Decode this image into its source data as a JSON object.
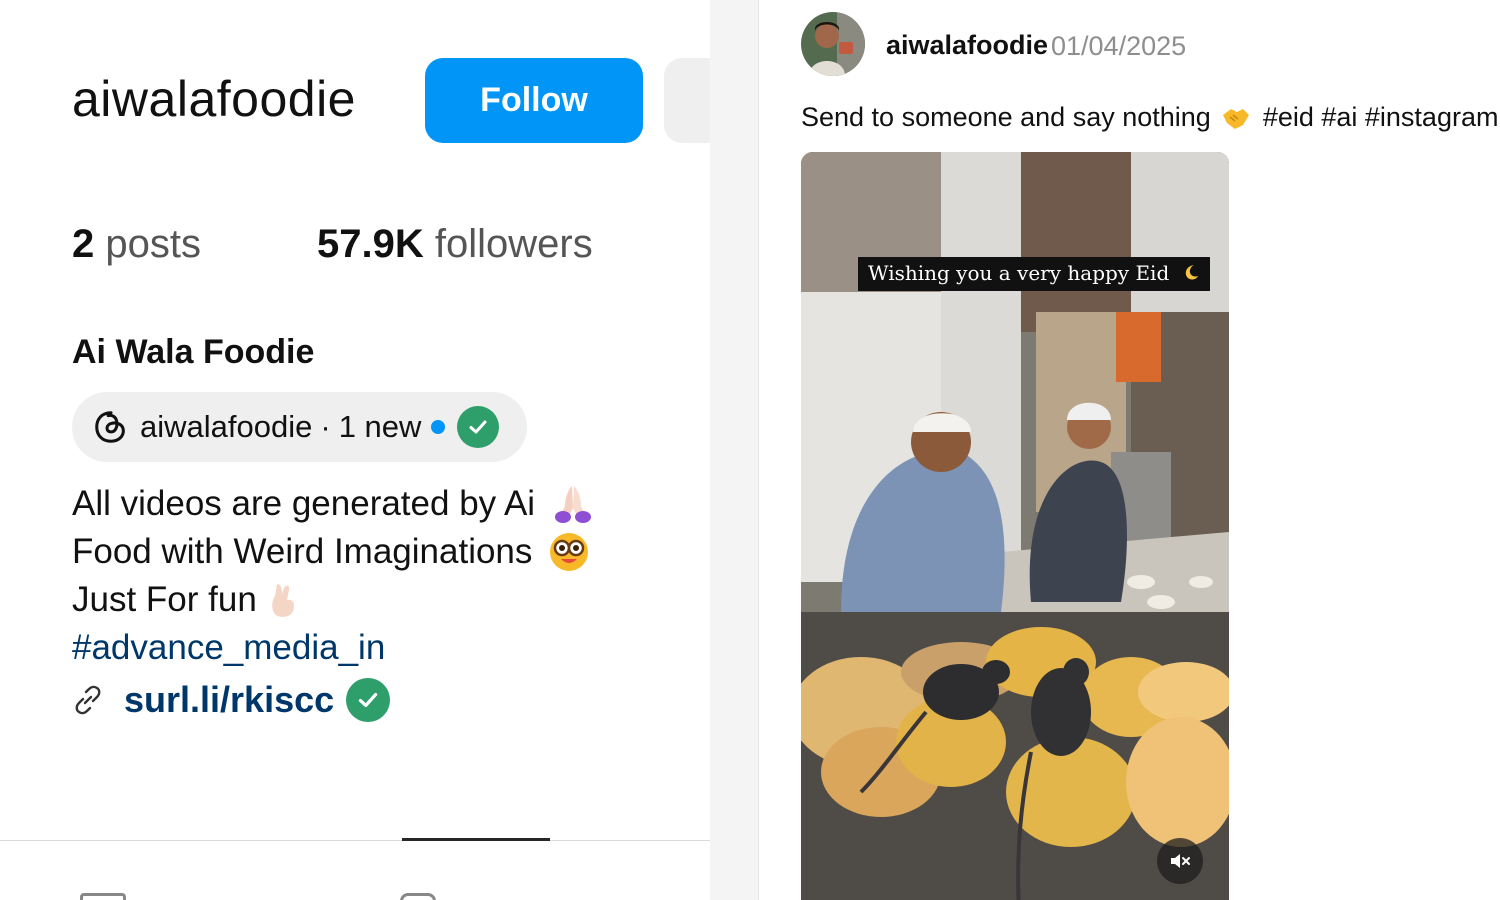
{
  "profile": {
    "username": "aiwalafoodie",
    "follow_label": "Follow",
    "posts_count": "2",
    "posts_word": "posts",
    "followers_count": "57.9K",
    "followers_word": "followers",
    "full_name": "Ai Wala Foodie",
    "threads": {
      "handle": "aiwalafoodie",
      "separator": "·",
      "new_count": "1 new"
    },
    "bio_lines": [
      "All videos are generated by Ai",
      "Food with Weird Imaginations",
      "Just For fun"
    ],
    "hashtag": "#advance_media_in",
    "link": "surl.li/rkiscc"
  },
  "post": {
    "username": "aiwalafoodie",
    "date": "01/04/2025",
    "caption_text": "Send to someone and say nothing",
    "caption_tags": "#eid #ai #instagramr",
    "video_overlay_text": "Wishing you a very happy Eid"
  },
  "colors": {
    "follow_button": "#0095f6",
    "link": "#00376b",
    "verified": "#2e9e6b"
  },
  "icons": {
    "threads": "threads-icon",
    "verified": "verified-check-icon",
    "link": "link-icon",
    "mute": "muted-speaker-icon"
  }
}
